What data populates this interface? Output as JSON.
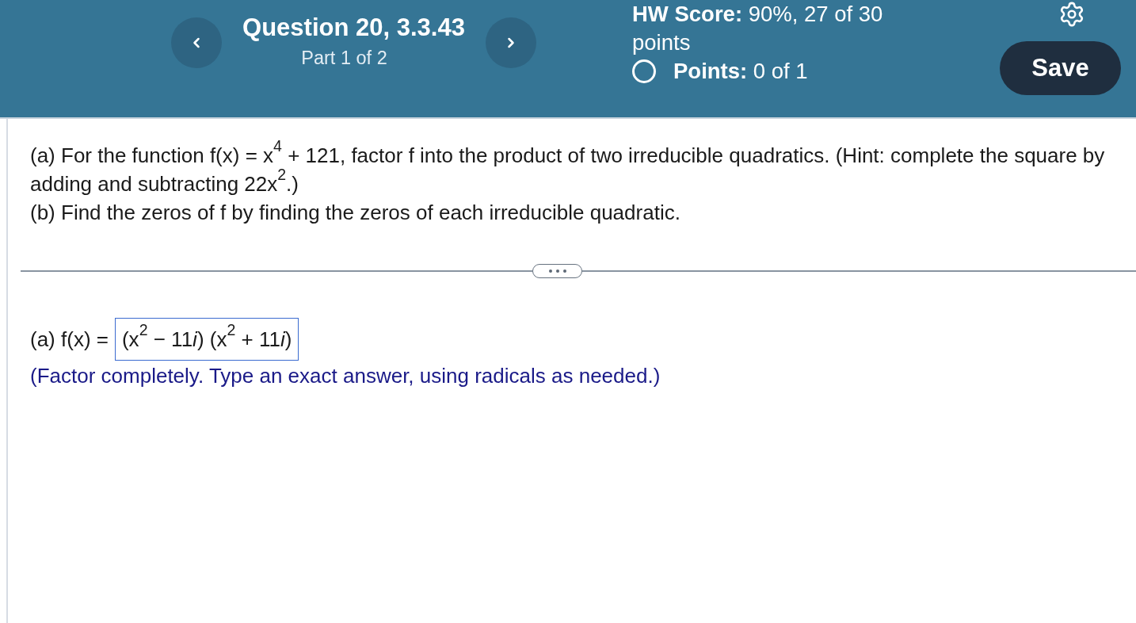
{
  "header": {
    "title": "Question 20, 3.3.43",
    "subtitle": "Part 1 of 2",
    "hw_score": "**HW Score:** 90%, 27 of 30 points",
    "points": "**Points:** 0 of 1",
    "save_button": "Save"
  },
  "question": {
    "paragraphs": [
      "(a) For the function f(x) = x$^{4}$ + 121, factor f into the product of two irreducible quadratics. (Hint: complete the square by adding and subtracting 22x$^{2}$.)",
      "(b) Find the zeros of f by finding the zeros of each irreducible quadratic."
    ]
  },
  "answer": {
    "label": "(a) f(x) =",
    "value_segments": [
      "(x$^{2}$ − 11",
      "*i*",
      ") (x$^{2}$ + 11",
      "*i*",
      ")"
    ],
    "instruction": "(Factor completely. Type an exact answer, using radicals as needed.)"
  }
}
